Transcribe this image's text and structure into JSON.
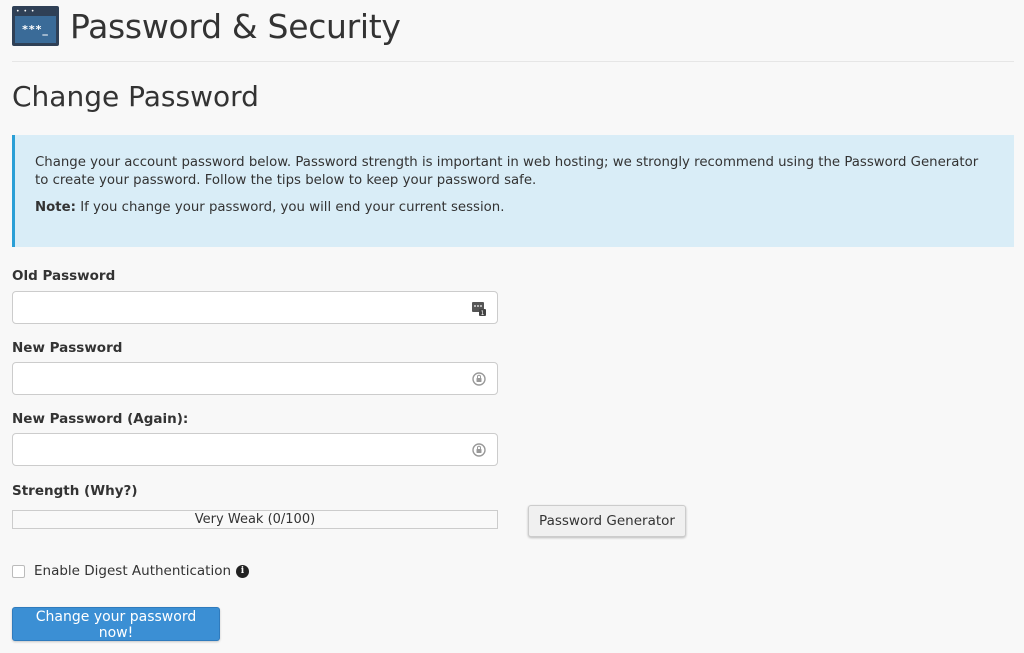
{
  "header": {
    "icon": "password-security-icon",
    "icon_text": "***_",
    "title": "Password & Security"
  },
  "section_title": "Change Password",
  "callout": {
    "text": "Change your account password below. Password strength is important in web hosting; we strongly recommend using the Password Generator to create your password. Follow the tips below to keep your password safe.",
    "note_label": "Note:",
    "note_text": " If you change your password, you will end your current session."
  },
  "fields": {
    "old_password": {
      "label": "Old Password",
      "value": "",
      "icon": "password-manager-icon"
    },
    "new_password": {
      "label": "New Password",
      "value": "",
      "icon": "lock-refresh-icon"
    },
    "new_password_again": {
      "label": "New Password (Again):",
      "value": "",
      "icon": "lock-refresh-icon"
    }
  },
  "strength": {
    "label": "Strength (Why?)",
    "text": "Very Weak (0/100)",
    "value": 0,
    "max": 100
  },
  "password_generator_label": "Password Generator",
  "digest_auth": {
    "label": "Enable Digest Authentication",
    "checked": false,
    "info_icon": "info-icon"
  },
  "submit_label": "Change your password now!",
  "colors": {
    "primary_button": "#3b8fd4",
    "callout_bg": "#d9edf7",
    "callout_border": "#2a9fd6"
  }
}
